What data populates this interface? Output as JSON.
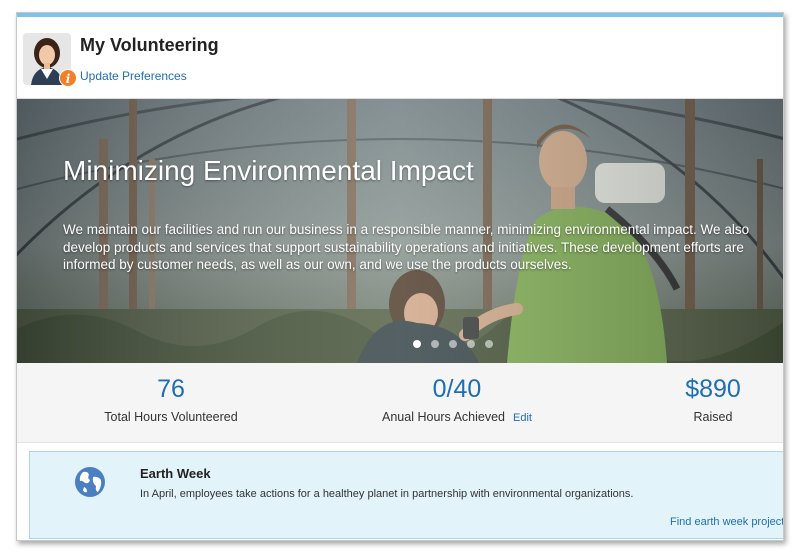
{
  "header": {
    "title": "My Volunteering",
    "preferences_link": "Update Preferences",
    "badge_glyph": "i"
  },
  "hero": {
    "title": "Minimizing Environmental Impact",
    "body": "We maintain our facilities and run our business in a responsible manner, minimizing environmental impact. We also develop products and services that support sustainability operations and initiatives. These development efforts are informed by customer needs, as well as our own, and we use the products ourselves.",
    "slide_count": 5,
    "active_slide": 1
  },
  "stats": [
    {
      "value": "76",
      "label": "Total Hours Volunteered"
    },
    {
      "value": "0/40",
      "label": "Anual Hours Achieved",
      "action": "Edit"
    },
    {
      "value": "$890",
      "label": "Raised"
    }
  ],
  "card": {
    "title": "Earth Week",
    "text": "In April, employees take actions for a healthey planet in partnership with environmental organizations.",
    "link": "Find earth week projects",
    "icon": "globe-icon"
  },
  "colors": {
    "link": "#1f6db3",
    "badge": "#f0812b",
    "card_bg": "#e2f3fa",
    "top_strip": "#7cc4ec"
  }
}
